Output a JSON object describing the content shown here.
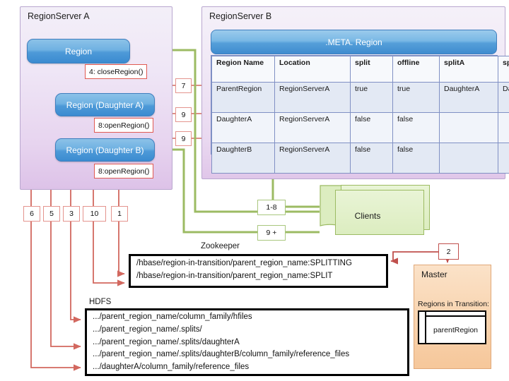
{
  "region_server_a": {
    "title": "RegionServer A",
    "regions": [
      {
        "label": "Region"
      },
      {
        "label": "Region (Daughter A)"
      },
      {
        "label": "Region (Daughter B)"
      }
    ],
    "callouts": [
      {
        "label": "4: closeRegion()"
      },
      {
        "label": "8:openRegion()"
      },
      {
        "label": "8:openRegion()"
      }
    ]
  },
  "region_server_b": {
    "title": "RegionServer B",
    "meta_header": ".META. Region",
    "meta_table": {
      "columns": [
        "Region Name",
        "Location",
        "split",
        "offline",
        "splitA",
        "splitB"
      ],
      "rows": [
        [
          "ParentRegion",
          "RegionServerA",
          "true",
          "true",
          "DaughterA",
          "DaughterB"
        ],
        [
          "DaughterA",
          "RegionServerA",
          "false",
          "false",
          "",
          ""
        ],
        [
          "DaughterB",
          "RegionServerA",
          "false",
          "false",
          "",
          ""
        ]
      ]
    }
  },
  "step_labels": {
    "to_meta_parent": "7",
    "to_meta_daughter_a": "9",
    "to_meta_daughter_b": "9",
    "left_6": "6",
    "left_5": "5",
    "left_3": "3",
    "left_10": "10",
    "left_1": "1",
    "clients_before": "1-8",
    "clients_after": "9 +",
    "master_step": "2"
  },
  "clients": {
    "label": "Clients"
  },
  "zookeeper": {
    "title": "Zookeeper",
    "lines": [
      "/hbase/region-in-transition/parent_region_name:SPLITTING",
      "/hbase/region-in-transition/parent_region_name:SPLIT"
    ]
  },
  "hdfs": {
    "title": "HDFS",
    "lines": [
      ".../parent_region_name/column_family/hfiles",
      ".../parent_region_name/.splits/",
      ".../parent_region_name/.splits/daughterA",
      ".../parent_region_name/.splits/daughterB/column_family/reference_files",
      ".../daughterA/column_family/reference_files"
    ]
  },
  "master": {
    "title": "Master",
    "regions_in_transition_label": "Regions in Transition:",
    "region_in_transition": "parentRegion"
  },
  "colors": {
    "red_arrow": "#d2685f",
    "green_arrow": "#9cbb63",
    "blue_region": "#4e9ad8",
    "panel_purple": "#e0c6e9",
    "master_orange": "#f8d3ae",
    "clients_green": "#dcedc0"
  }
}
